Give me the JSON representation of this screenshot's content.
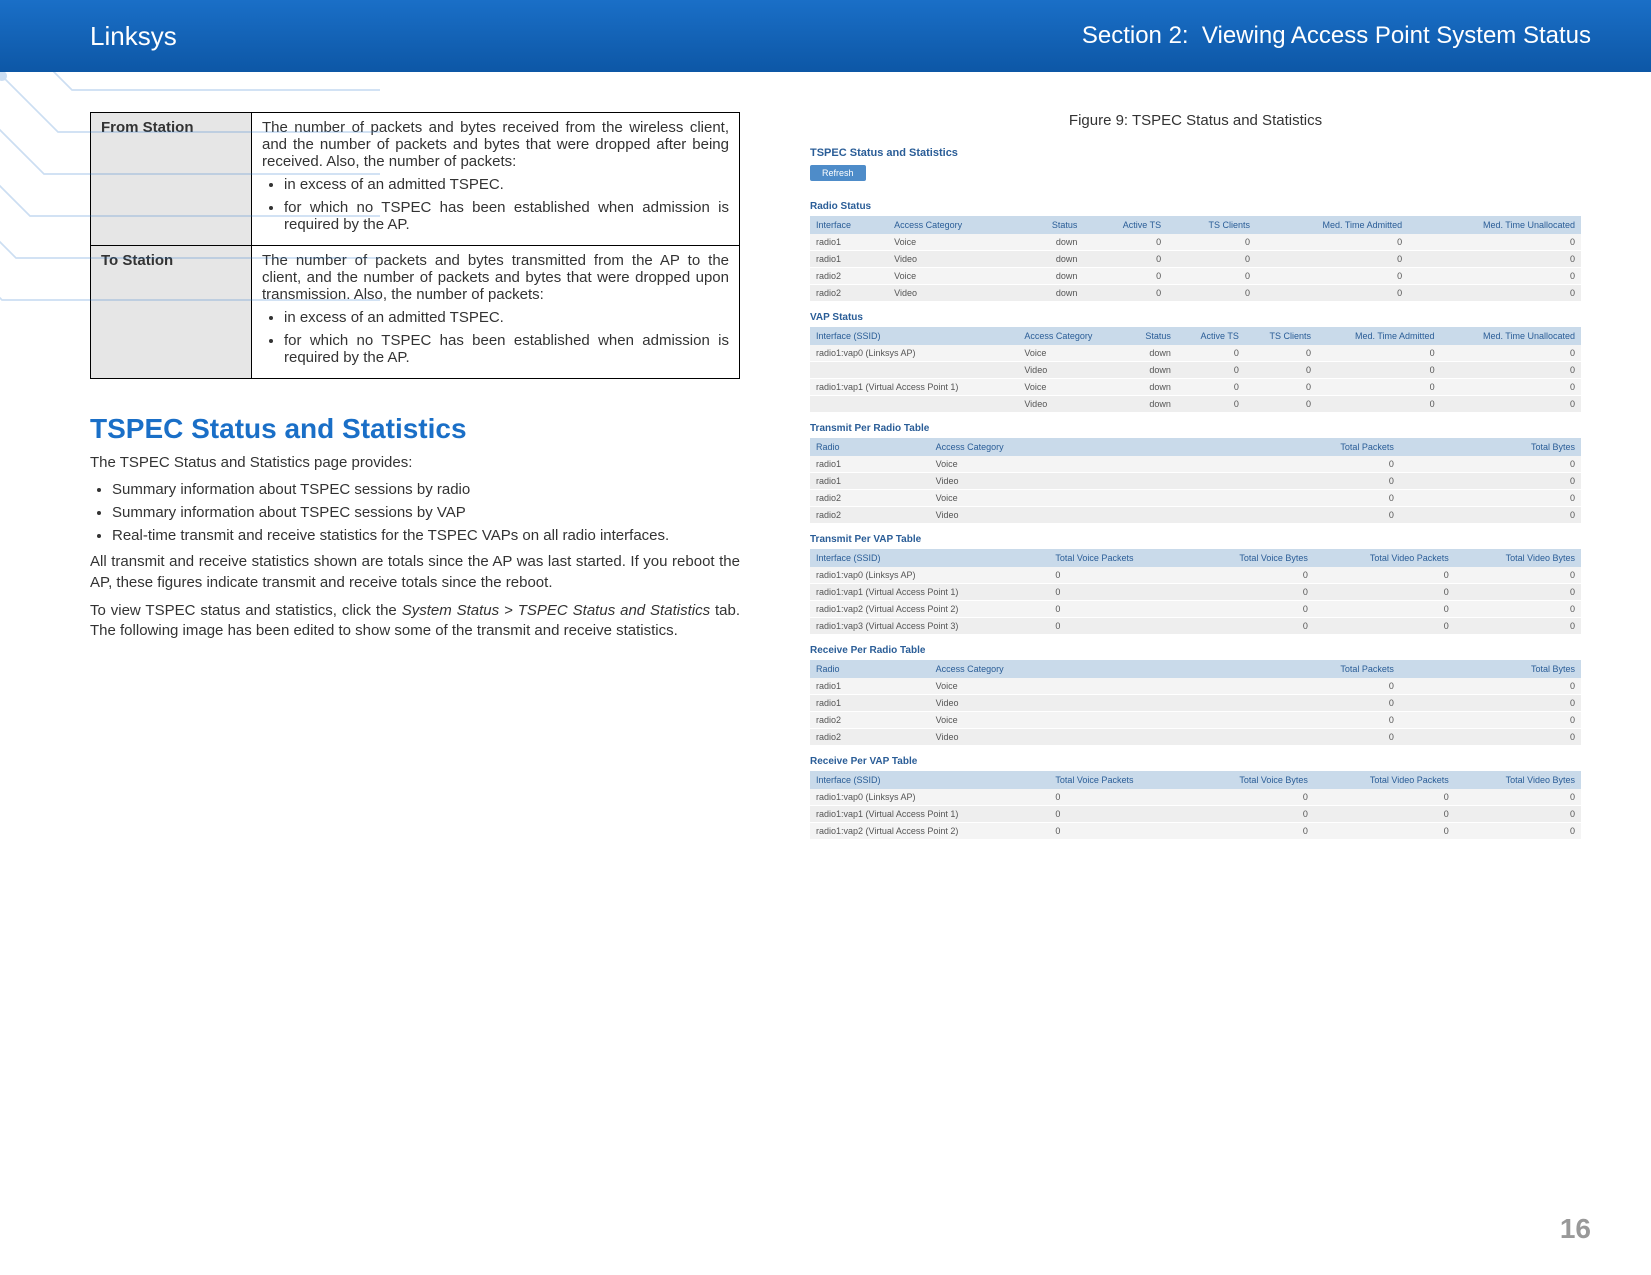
{
  "header": {
    "brand": "Linksys",
    "section_label": "Section 2:",
    "section_name": "Viewing Access Point System Status"
  },
  "def_table": {
    "rows": [
      {
        "term": "From Station",
        "desc": "The number of packets and bytes received from the wireless client, and the number of packets and bytes that were dropped after being received. Also, the number of packets:",
        "bullets": [
          "in excess of an admitted TSPEC.",
          "for which no TSPEC has been established when admission is required by the AP."
        ]
      },
      {
        "term": "To Station",
        "desc": "The number of packets and bytes transmitted from the AP to the client, and the number of packets and bytes that were dropped upon transmission. Also, the number of packets:",
        "bullets": [
          "in excess of an admitted TSPEC.",
          "for which no TSPEC has been established when admission is required by the AP."
        ]
      }
    ]
  },
  "tspec_section": {
    "heading": "TSPEC Status and Statistics",
    "intro": "The TSPEC Status and Statistics page provides:",
    "intro_bullets": [
      "Summary information about TSPEC sessions by radio",
      "Summary information about TSPEC sessions by VAP",
      "Real-time transmit and receive statistics for the TSPEC VAPs on all radio interfaces."
    ],
    "para1": "All transmit and receive statistics shown are totals since the AP was last started. If you reboot the AP, these figures indicate transmit and receive totals since the reboot.",
    "para2_pre": "To view TSPEC status and statistics, click the ",
    "para2_em": "System Status > TSPEC Status and Statistics",
    "para2_post": " tab. The following image has been edited to show some of the transmit and receive statistics."
  },
  "figure": {
    "caption": "Figure 9: TSPEC Status and Statistics",
    "panel_title": "TSPEC Status and Statistics",
    "refresh_label": "Refresh",
    "blocks": {
      "radio_status": {
        "title": "Radio Status",
        "headers": [
          "Interface",
          "Access Category",
          "Status",
          "Active TS",
          "TS Clients",
          "Med. Time Admitted",
          "Med. Time Unallocated"
        ],
        "rows": [
          [
            "radio1",
            "Voice",
            "down",
            "0",
            "0",
            "0",
            "0"
          ],
          [
            "radio1",
            "Video",
            "down",
            "0",
            "0",
            "0",
            "0"
          ],
          [
            "radio2",
            "Voice",
            "down",
            "0",
            "0",
            "0",
            "0"
          ],
          [
            "radio2",
            "Video",
            "down",
            "0",
            "0",
            "0",
            "0"
          ]
        ]
      },
      "vap_status": {
        "title": "VAP Status",
        "headers": [
          "Interface (SSID)",
          "Access Category",
          "Status",
          "Active TS",
          "TS Clients",
          "Med. Time Admitted",
          "Med. Time Unallocated"
        ],
        "rows": [
          [
            "radio1:vap0 (Linksys AP)",
            "Voice",
            "down",
            "0",
            "0",
            "0",
            "0"
          ],
          [
            "",
            "Video",
            "down",
            "0",
            "0",
            "0",
            "0"
          ],
          [
            "radio1:vap1 (Virtual Access Point 1)",
            "Voice",
            "down",
            "0",
            "0",
            "0",
            "0"
          ],
          [
            "",
            "Video",
            "down",
            "0",
            "0",
            "0",
            "0"
          ]
        ]
      },
      "tx_radio": {
        "title": "Transmit Per Radio Table",
        "headers": [
          "Radio",
          "Access Category",
          "Total Packets",
          "Total Bytes"
        ],
        "rows": [
          [
            "radio1",
            "Voice",
            "0",
            "0"
          ],
          [
            "radio1",
            "Video",
            "0",
            "0"
          ],
          [
            "radio2",
            "Voice",
            "0",
            "0"
          ],
          [
            "radio2",
            "Video",
            "0",
            "0"
          ]
        ]
      },
      "tx_vap": {
        "title": "Transmit Per VAP Table",
        "headers": [
          "Interface (SSID)",
          "Total Voice Packets",
          "Total Voice Bytes",
          "Total Video Packets",
          "Total Video Bytes"
        ],
        "rows": [
          [
            "radio1:vap0 (Linksys AP)",
            "0",
            "0",
            "0",
            "0"
          ],
          [
            "radio1:vap1 (Virtual Access Point 1)",
            "0",
            "0",
            "0",
            "0"
          ],
          [
            "radio1:vap2 (Virtual Access Point 2)",
            "0",
            "0",
            "0",
            "0"
          ],
          [
            "radio1:vap3 (Virtual Access Point 3)",
            "0",
            "0",
            "0",
            "0"
          ]
        ]
      },
      "rx_radio": {
        "title": "Receive Per Radio Table",
        "headers": [
          "Radio",
          "Access Category",
          "Total Packets",
          "Total Bytes"
        ],
        "rows": [
          [
            "radio1",
            "Voice",
            "0",
            "0"
          ],
          [
            "radio1",
            "Video",
            "0",
            "0"
          ],
          [
            "radio2",
            "Voice",
            "0",
            "0"
          ],
          [
            "radio2",
            "Video",
            "0",
            "0"
          ]
        ]
      },
      "rx_vap": {
        "title": "Receive Per VAP Table",
        "headers": [
          "Interface (SSID)",
          "Total Voice Packets",
          "Total Voice Bytes",
          "Total Video Packets",
          "Total Video Bytes"
        ],
        "rows": [
          [
            "radio1:vap0 (Linksys AP)",
            "0",
            "0",
            "0",
            "0"
          ],
          [
            "radio1:vap1 (Virtual Access Point 1)",
            "0",
            "0",
            "0",
            "0"
          ],
          [
            "radio1:vap2 (Virtual Access Point 2)",
            "0",
            "0",
            "0",
            "0"
          ]
        ]
      }
    }
  },
  "page_number": "16"
}
